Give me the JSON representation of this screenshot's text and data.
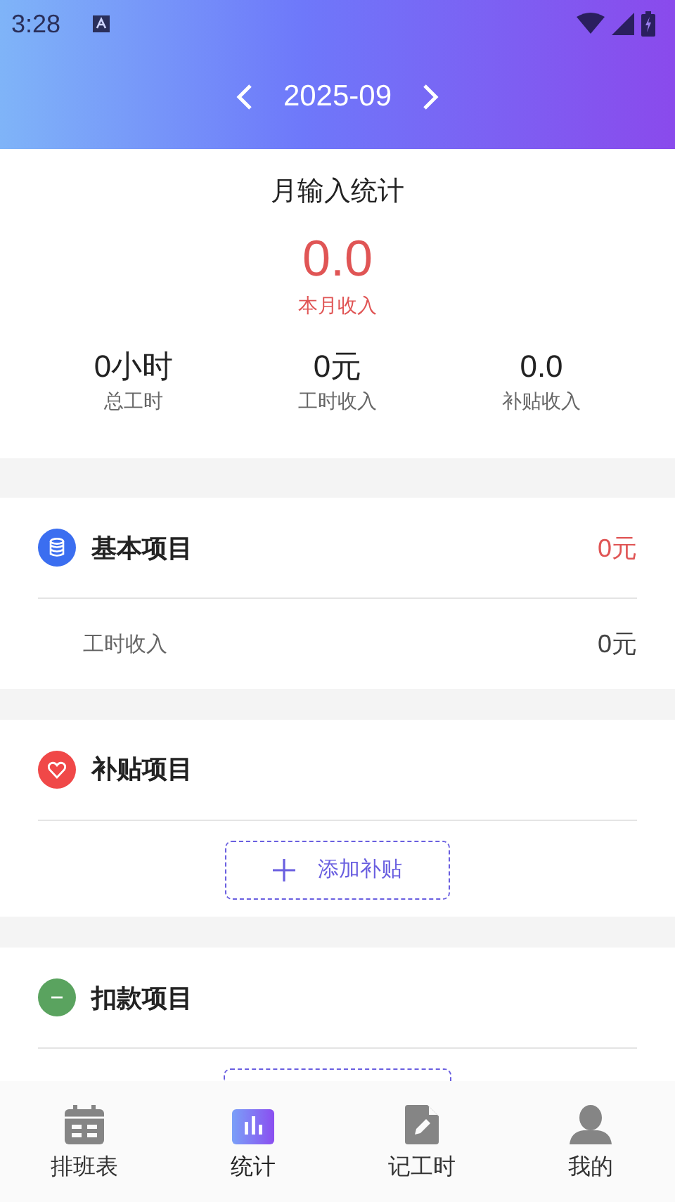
{
  "status_bar": {
    "time": "3:28"
  },
  "month_nav": {
    "month": "2025-09"
  },
  "summary": {
    "title": "月输入统计",
    "income": "0.0",
    "income_label": "本月收入",
    "stats": [
      {
        "value": "0小时",
        "label": "总工时"
      },
      {
        "value": "0元",
        "label": "工时收入"
      },
      {
        "value": "0.0",
        "label": "补贴收入"
      }
    ]
  },
  "sections": [
    {
      "kind": "basic",
      "title": "基本项目",
      "color": "#3b6ef0",
      "total": "0元",
      "rows": [
        {
          "label": "工时收入",
          "value": "0元"
        }
      ]
    },
    {
      "kind": "subsidy",
      "title": "补贴项目",
      "color": "#f04848",
      "add_button": "添加补贴"
    },
    {
      "kind": "deduction",
      "title": "扣款项目",
      "color": "#5aa35f"
    }
  ],
  "tab_bar": [
    {
      "kind": "calendar",
      "label": "排班表",
      "selected": false
    },
    {
      "kind": "chart",
      "label": "统计",
      "selected": true
    },
    {
      "kind": "document",
      "label": "记工时",
      "selected": false
    },
    {
      "kind": "person",
      "label": "我的",
      "selected": false
    }
  ]
}
